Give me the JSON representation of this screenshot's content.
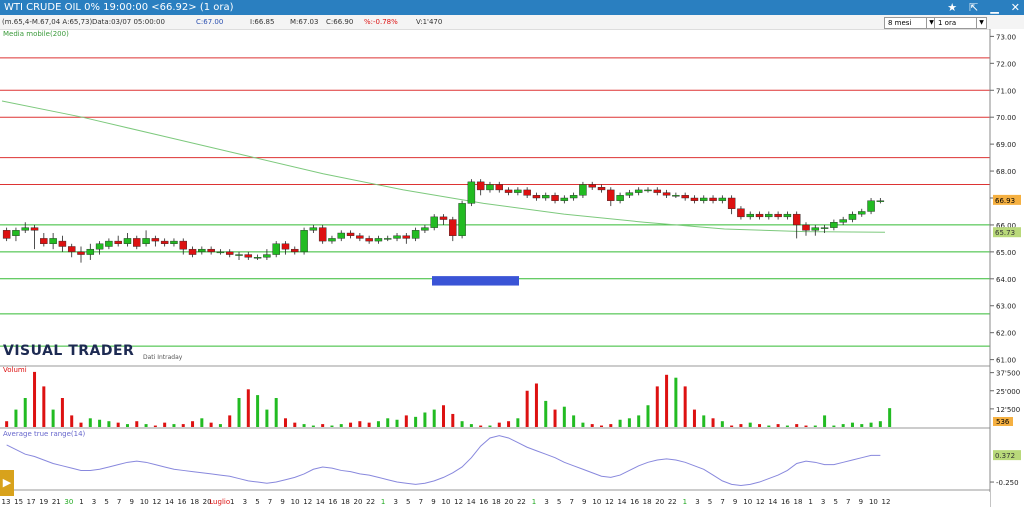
{
  "window": {
    "title": "WTI CRUDE OIL 0% 19:00:00  <66.92> (1 ora)",
    "icons": [
      "star-icon",
      "pin-icon",
      "minimize-icon",
      "close-icon"
    ]
  },
  "infobar": {
    "indicator": "(m.65,4-M.67,04 A:65,73)",
    "date": "Data:03/07 05:00:00",
    "c": "C:67.00",
    "i": "I:66.85",
    "m": "M:67.03",
    "ch": "C:66.90",
    "pct": "%:-0.78%",
    "v": "V:1'470"
  },
  "selectors": {
    "period": "8 mesi",
    "timeframe": "1 ora"
  },
  "colors": {
    "titlebar": "#2a7fc0",
    "up": "#22bb22",
    "down": "#dd1111",
    "ma": "#7dc97d",
    "atr": "#8888dd",
    "resistance": "#dd3333",
    "support": "#33bb33",
    "box": "#3a54d6"
  },
  "labels": {
    "ma": "Media mobile(200)",
    "volume": "Volumi",
    "atr": "Average true range(14)",
    "brand": "VISUAL TRADER",
    "brand_sub": "Dati Intraday"
  },
  "chart_data": [
    {
      "type": "candlestick",
      "name": "price",
      "y_ticks": [
        "73.00",
        "72.00",
        "71.00",
        "70.00",
        "69.00",
        "68.00",
        "67.00",
        "66.00",
        "65.00",
        "64.00",
        "63.00",
        "62.00",
        "61.00"
      ],
      "ylim": [
        60.8,
        73.2
      ],
      "last_price": "66.93",
      "ma_label_value": "65.73",
      "resistance_levels": [
        72.2,
        71.0,
        70.0,
        68.5,
        67.5
      ],
      "support_levels": [
        66.0,
        65.0,
        64.0,
        62.7,
        61.5
      ],
      "ma_200": [
        70.6,
        70.0,
        69.3,
        68.6,
        67.9,
        67.3,
        66.8,
        66.4,
        66.1,
        65.85,
        65.75,
        65.73
      ],
      "candles": [
        [
          65.8,
          65.5,
          65.9,
          65.4
        ],
        [
          65.6,
          65.8,
          65.9,
          65.4
        ],
        [
          65.8,
          65.9,
          66.1,
          65.7
        ],
        [
          65.9,
          65.8,
          66.0,
          65.1
        ],
        [
          65.5,
          65.3,
          65.7,
          65.2
        ],
        [
          65.3,
          65.5,
          65.7,
          65.1
        ],
        [
          65.4,
          65.2,
          65.6,
          65.0
        ],
        [
          65.2,
          65.0,
          65.3,
          64.8
        ],
        [
          65.0,
          64.9,
          65.2,
          64.6
        ],
        [
          64.9,
          65.1,
          65.3,
          64.7
        ],
        [
          65.1,
          65.3,
          65.4,
          64.9
        ],
        [
          65.2,
          65.4,
          65.5,
          65.1
        ],
        [
          65.4,
          65.3,
          65.6,
          65.2
        ],
        [
          65.3,
          65.5,
          65.7,
          65.2
        ],
        [
          65.5,
          65.2,
          65.6,
          65.1
        ],
        [
          65.3,
          65.5,
          65.8,
          65.2
        ],
        [
          65.5,
          65.4,
          65.6,
          65.2
        ],
        [
          65.4,
          65.3,
          65.5,
          65.2
        ],
        [
          65.3,
          65.4,
          65.5,
          65.2
        ],
        [
          65.4,
          65.1,
          65.5,
          64.9
        ],
        [
          65.1,
          64.9,
          65.2,
          64.8
        ],
        [
          65.0,
          65.1,
          65.2,
          64.9
        ],
        [
          65.1,
          65.0,
          65.2,
          64.9
        ],
        [
          65.0,
          65.0,
          65.1,
          64.9
        ],
        [
          65.0,
          64.9,
          65.1,
          64.8
        ],
        [
          64.9,
          64.9,
          65.0,
          64.7
        ],
        [
          64.9,
          64.8,
          65.0,
          64.7
        ],
        [
          64.8,
          64.8,
          64.9,
          64.7
        ],
        [
          64.8,
          64.9,
          65.1,
          64.7
        ],
        [
          64.9,
          65.3,
          65.4,
          64.8
        ],
        [
          65.3,
          65.1,
          65.4,
          64.9
        ],
        [
          65.1,
          65.0,
          65.2,
          64.9
        ],
        [
          65.0,
          65.8,
          65.9,
          64.9
        ],
        [
          65.8,
          65.9,
          66.0,
          65.7
        ],
        [
          65.9,
          65.4,
          66.0,
          65.3
        ],
        [
          65.4,
          65.5,
          65.6,
          65.3
        ],
        [
          65.5,
          65.7,
          65.8,
          65.4
        ],
        [
          65.7,
          65.6,
          65.8,
          65.5
        ],
        [
          65.6,
          65.5,
          65.7,
          65.4
        ],
        [
          65.5,
          65.4,
          65.6,
          65.3
        ],
        [
          65.4,
          65.5,
          65.6,
          65.3
        ],
        [
          65.5,
          65.5,
          65.6,
          65.4
        ],
        [
          65.5,
          65.6,
          65.7,
          65.4
        ],
        [
          65.6,
          65.5,
          65.7,
          65.3
        ],
        [
          65.5,
          65.8,
          65.9,
          65.4
        ],
        [
          65.8,
          65.9,
          66.0,
          65.7
        ],
        [
          65.9,
          66.3,
          66.4,
          65.8
        ],
        [
          66.3,
          66.2,
          66.4,
          66.0
        ],
        [
          66.2,
          65.6,
          66.3,
          65.4
        ],
        [
          65.6,
          66.8,
          66.9,
          65.5
        ],
        [
          66.8,
          67.6,
          67.7,
          66.7
        ],
        [
          67.6,
          67.3,
          67.7,
          67.1
        ],
        [
          67.3,
          67.5,
          67.6,
          67.2
        ],
        [
          67.5,
          67.3,
          67.6,
          67.2
        ],
        [
          67.3,
          67.2,
          67.4,
          67.1
        ],
        [
          67.2,
          67.3,
          67.4,
          67.1
        ],
        [
          67.3,
          67.1,
          67.4,
          67.0
        ],
        [
          67.1,
          67.0,
          67.2,
          66.9
        ],
        [
          67.0,
          67.1,
          67.2,
          66.9
        ],
        [
          67.1,
          66.9,
          67.2,
          66.8
        ],
        [
          66.9,
          67.0,
          67.1,
          66.8
        ],
        [
          67.0,
          67.1,
          67.2,
          66.9
        ],
        [
          67.1,
          67.5,
          67.6,
          67.0
        ],
        [
          67.5,
          67.4,
          67.6,
          67.3
        ],
        [
          67.4,
          67.3,
          67.5,
          67.2
        ],
        [
          67.3,
          66.9,
          67.4,
          66.7
        ],
        [
          66.9,
          67.1,
          67.2,
          66.8
        ],
        [
          67.1,
          67.2,
          67.3,
          67.0
        ],
        [
          67.2,
          67.3,
          67.4,
          67.1
        ],
        [
          67.3,
          67.3,
          67.4,
          67.2
        ],
        [
          67.3,
          67.2,
          67.4,
          67.1
        ],
        [
          67.2,
          67.1,
          67.3,
          67.0
        ],
        [
          67.1,
          67.1,
          67.2,
          67.0
        ],
        [
          67.1,
          67.0,
          67.2,
          66.9
        ],
        [
          67.0,
          66.9,
          67.1,
          66.8
        ],
        [
          66.9,
          67.0,
          67.1,
          66.8
        ],
        [
          67.0,
          66.9,
          67.1,
          66.8
        ],
        [
          66.9,
          67.0,
          67.1,
          66.8
        ],
        [
          67.0,
          66.6,
          67.1,
          66.4
        ],
        [
          66.6,
          66.3,
          66.7,
          66.2
        ],
        [
          66.3,
          66.4,
          66.5,
          66.2
        ],
        [
          66.4,
          66.3,
          66.5,
          66.2
        ],
        [
          66.3,
          66.4,
          66.5,
          66.2
        ],
        [
          66.4,
          66.3,
          66.5,
          66.2
        ],
        [
          66.3,
          66.4,
          66.5,
          66.2
        ],
        [
          66.4,
          66.0,
          66.5,
          65.5
        ],
        [
          66.0,
          65.8,
          66.1,
          65.6
        ],
        [
          65.8,
          65.9,
          66.0,
          65.6
        ],
        [
          65.9,
          65.9,
          66.0,
          65.7
        ],
        [
          65.9,
          66.1,
          66.2,
          65.8
        ],
        [
          66.1,
          66.2,
          66.3,
          66.0
        ],
        [
          66.2,
          66.4,
          66.5,
          66.1
        ],
        [
          66.4,
          66.5,
          66.6,
          66.3
        ],
        [
          66.5,
          66.9,
          67.0,
          66.4
        ],
        [
          66.9,
          66.9,
          67.0,
          66.8
        ]
      ],
      "volume_ticks": [
        "37'500",
        "25'000",
        "12'500"
      ],
      "volume_last": "536",
      "volumes": [
        4000,
        12000,
        20000,
        38000,
        28000,
        12000,
        20000,
        8000,
        3000,
        6000,
        5000,
        4000,
        3000,
        2000,
        4000,
        2000,
        1000,
        3000,
        2000,
        2000,
        4000,
        6000,
        3000,
        2000,
        8000,
        20000,
        26000,
        22000,
        12000,
        20000,
        6000,
        3000,
        2000,
        1000,
        2000,
        1000,
        2000,
        3000,
        4000,
        3000,
        4000,
        6000,
        5000,
        8000,
        7000,
        10000,
        12000,
        15000,
        9000,
        4000,
        2000,
        1000,
        1000,
        3000,
        4000,
        6000,
        25000,
        30000,
        18000,
        12000,
        14000,
        8000,
        3000,
        2000,
        1000,
        2000,
        5000,
        6000,
        8000,
        15000,
        28000,
        36000,
        34000,
        28000,
        12000,
        8000,
        6000,
        4000,
        1000,
        2000,
        3000,
        2000,
        1000,
        2000,
        1000,
        2000,
        1000,
        1000,
        8000,
        1000,
        2000,
        3000,
        2000,
        3000,
        4000,
        13000
      ],
      "atr_ticks": [
        "-0.250"
      ],
      "atr_last": "0.372",
      "atr": [
        0.46,
        0.42,
        0.38,
        0.36,
        0.33,
        0.3,
        0.28,
        0.26,
        0.24,
        0.24,
        0.25,
        0.27,
        0.29,
        0.31,
        0.32,
        0.31,
        0.29,
        0.27,
        0.25,
        0.24,
        0.23,
        0.22,
        0.21,
        0.2,
        0.19,
        0.17,
        0.15,
        0.14,
        0.13,
        0.14,
        0.16,
        0.18,
        0.21,
        0.25,
        0.27,
        0.26,
        0.24,
        0.23,
        0.21,
        0.2,
        0.18,
        0.16,
        0.14,
        0.13,
        0.12,
        0.13,
        0.15,
        0.18,
        0.22,
        0.27,
        0.35,
        0.45,
        0.52,
        0.54,
        0.52,
        0.48,
        0.44,
        0.41,
        0.38,
        0.35,
        0.31,
        0.28,
        0.25,
        0.22,
        0.19,
        0.18,
        0.2,
        0.24,
        0.28,
        0.31,
        0.33,
        0.34,
        0.33,
        0.31,
        0.28,
        0.25,
        0.2,
        0.15,
        0.12,
        0.11,
        0.12,
        0.14,
        0.17,
        0.2,
        0.24,
        0.3,
        0.32,
        0.31,
        0.29,
        0.29,
        0.31,
        0.33,
        0.35,
        0.37,
        0.37
      ],
      "x_ticks": [
        "13",
        "15",
        "17",
        "19",
        "21",
        "30",
        "1",
        "3",
        "5",
        "7",
        "9",
        "10",
        "12",
        "14",
        "16",
        "18",
        "20",
        "Luglio",
        "1",
        "3",
        "5",
        "7",
        "9",
        "10",
        "12",
        "14",
        "16",
        "18",
        "20",
        "22",
        "1",
        "3",
        "5",
        "7",
        "9",
        "10",
        "12",
        "14",
        "16",
        "18",
        "20",
        "22",
        "1",
        "3",
        "5",
        "7",
        "9",
        "10",
        "12",
        "14",
        "16",
        "18",
        "20",
        "22",
        "1",
        "3",
        "5",
        "7",
        "9",
        "10",
        "12",
        "14",
        "16",
        "18",
        "1",
        "3",
        "5",
        "7",
        "9",
        "10",
        "12"
      ]
    }
  ]
}
